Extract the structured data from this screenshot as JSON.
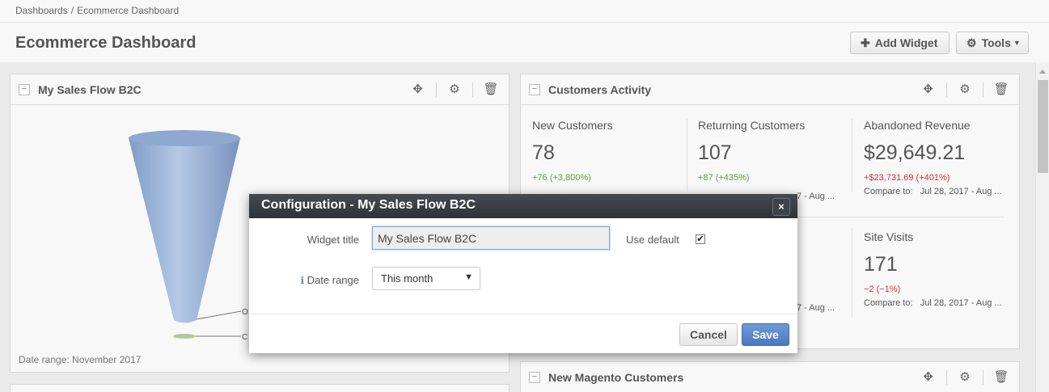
{
  "breadcrumb": {
    "items": [
      "Dashboards",
      "Ecommerce Dashboard"
    ],
    "separator": "/"
  },
  "header": {
    "title": "Ecommerce Dashboard",
    "add_widget_label": "Add Widget",
    "tools_label": "Tools",
    "add_icon": "plus-icon",
    "tools_icon": "gear-icon"
  },
  "widgets": {
    "sales_flow": {
      "title": "My Sales Flow B2C",
      "collapse_glyph": "−",
      "funnel_labels": [
        "O",
        "C"
      ],
      "date_range_text": "Date range: November 2017"
    },
    "customers_activity": {
      "title": "Customers Activity",
      "collapse_glyph": "−",
      "metrics": [
        {
          "label": "New Customers",
          "value": "78",
          "change": "+76 (+3,800%)",
          "change_status": "positive"
        },
        {
          "label": "Returning Customers",
          "value": "107",
          "change": "+87 (+435%)",
          "change_status": "positive",
          "compare_partial": "7 - Aug ..."
        },
        {
          "label": "Abandoned Revenue",
          "value": "$29,649.21",
          "change": "+$23,731.69 (+401%)",
          "change_status": "negative",
          "compare_label": "Compare to:",
          "compare_value": "Jul 28, 2017 - Aug ..."
        },
        {
          "compare_partial": "7 - Aug ..."
        },
        {
          "label": "Site Visits",
          "value": "171",
          "change": "−2 (−1%)",
          "change_status": "negative",
          "compare_label": "Compare to:",
          "compare_value": "Jul 28, 2017 - Aug ..."
        }
      ]
    },
    "new_magento_customers": {
      "title": "New Magento Customers",
      "collapse_glyph": "−"
    }
  },
  "tool_icons": [
    "move-icon",
    "gear-icon",
    "trash-icon"
  ],
  "modal": {
    "title": "Configuration - My Sales Flow B2C",
    "close_glyph": "×",
    "widget_title_label": "Widget title",
    "widget_title_value": "My Sales Flow B2C",
    "use_default_label": "Use default",
    "use_default_checked": true,
    "check_glyph": "✔",
    "date_range_label": "Date range",
    "date_range_value": "This month",
    "date_range_arrow": "▼",
    "info_icon": "info-icon",
    "cancel_label": "Cancel",
    "save_label": "Save"
  },
  "colors": {
    "save_button": "#4a78c0",
    "modal_header": "#343a40",
    "positive": "#5f9e3b",
    "negative": "#d9312f",
    "funnel": "#9db5d6"
  }
}
